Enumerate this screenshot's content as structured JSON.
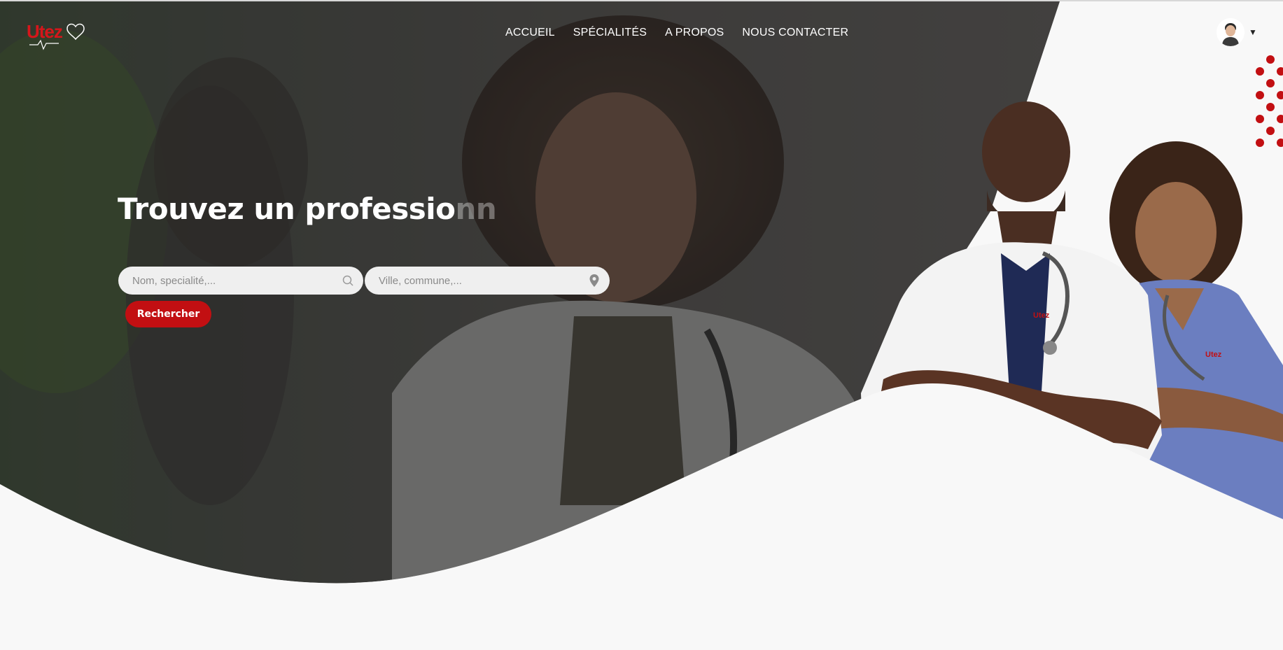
{
  "brand": {
    "logo_text": "Utez"
  },
  "nav": {
    "items": [
      {
        "label": "ACCUEIL"
      },
      {
        "label": "SPÉCIALITÉS"
      },
      {
        "label": "A PROPOS"
      },
      {
        "label": "NOUS CONTACTER"
      }
    ]
  },
  "hero": {
    "headline_main": "Trouvez un professio",
    "headline_fade": "nn"
  },
  "search": {
    "query_placeholder": "Nom, specialité,...",
    "location_placeholder": "Ville, commune,...",
    "submit_label": "Rechercher"
  },
  "badges": {
    "coat_logo": "Utez"
  },
  "colors": {
    "accent": "#c20f12",
    "overlay": "#3a3a3a",
    "background": "#f8f8f8"
  },
  "icons": {
    "search": "search-icon",
    "location": "map-pin-icon",
    "user": "avatar",
    "dropdown": "chevron-down-icon"
  }
}
